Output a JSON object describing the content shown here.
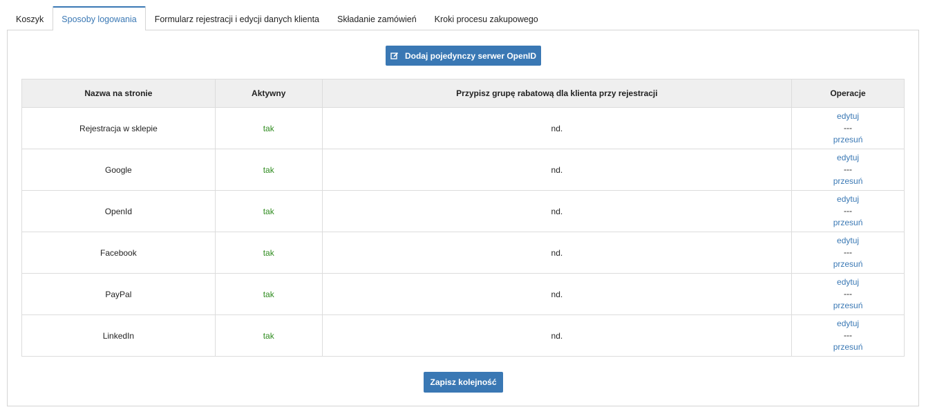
{
  "tabs": [
    {
      "label": "Koszyk",
      "active": false
    },
    {
      "label": "Sposoby logowania",
      "active": true
    },
    {
      "label": "Formularz rejestracji i edycji danych klienta",
      "active": false
    },
    {
      "label": "Składanie zamówień",
      "active": false
    },
    {
      "label": "Kroki procesu zakupowego",
      "active": false
    }
  ],
  "add_button": {
    "label": "Dodaj pojedynczy serwer OpenID",
    "icon": "edit-icon"
  },
  "table": {
    "headers": [
      "Nazwa na stronie",
      "Aktywny",
      "Przypisz grupę rabatową dla klienta przy rejestracji",
      "Operacje"
    ],
    "rows": [
      {
        "name": "Rejestracja w sklepie",
        "active": "tak",
        "discount_group": "nd.",
        "edit": "edytuj",
        "sep": "---",
        "move": "przesuń"
      },
      {
        "name": "Google",
        "active": "tak",
        "discount_group": "nd.",
        "edit": "edytuj",
        "sep": "---",
        "move": "przesuń"
      },
      {
        "name": "OpenId",
        "active": "tak",
        "discount_group": "nd.",
        "edit": "edytuj",
        "sep": "---",
        "move": "przesuń"
      },
      {
        "name": "Facebook",
        "active": "tak",
        "discount_group": "nd.",
        "edit": "edytuj",
        "sep": "---",
        "move": "przesuń"
      },
      {
        "name": "PayPal",
        "active": "tak",
        "discount_group": "nd.",
        "edit": "edytuj",
        "sep": "---",
        "move": "przesuń"
      },
      {
        "name": "LinkedIn",
        "active": "tak",
        "discount_group": "nd.",
        "edit": "edytuj",
        "sep": "---",
        "move": "przesuń"
      }
    ]
  },
  "save_button": {
    "label": "Zapisz kolejność"
  },
  "colors": {
    "accent": "#3a78b4",
    "active_text": "#2e8b1e",
    "header_bg": "#efefef"
  }
}
